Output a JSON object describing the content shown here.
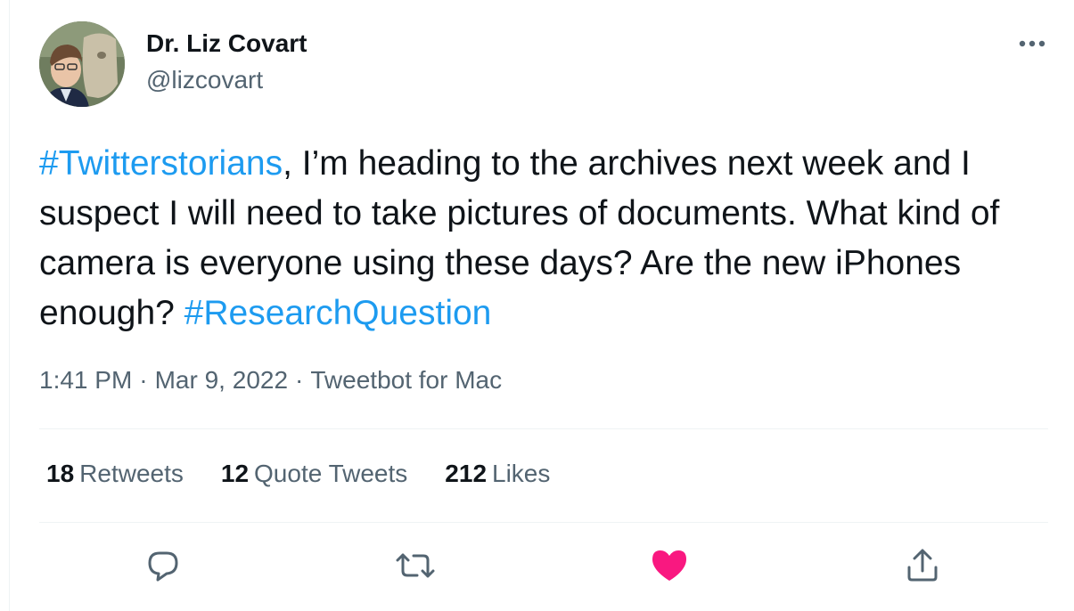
{
  "author": {
    "display_name": "Dr. Liz Covart",
    "handle": "@lizcovart"
  },
  "tweet": {
    "hashtag_1": "#Twitterstorians",
    "text_1": ", I’m heading to the archives next week and I suspect I will need to take pictures of documents. What kind of camera is everyone using these days? Are the new iPhones enough? ",
    "hashtag_2": "#ResearchQuestion"
  },
  "meta": {
    "time": "1:41 PM",
    "date": "Mar 9, 2022",
    "source": "Tweetbot for Mac",
    "separator": "·"
  },
  "stats": {
    "retweets_count": "18",
    "retweets_label": "Retweets",
    "quotes_count": "12",
    "quotes_label": "Quote Tweets",
    "likes_count": "212",
    "likes_label": "Likes"
  },
  "icons": {
    "more": "more-horizontal-icon",
    "reply": "reply-icon",
    "retweet": "retweet-icon",
    "like": "heart-filled-icon",
    "share": "share-icon"
  },
  "colors": {
    "accent": "#1d9bf0",
    "like": "#f91880",
    "text": "#0f1419",
    "secondary": "#536471"
  }
}
